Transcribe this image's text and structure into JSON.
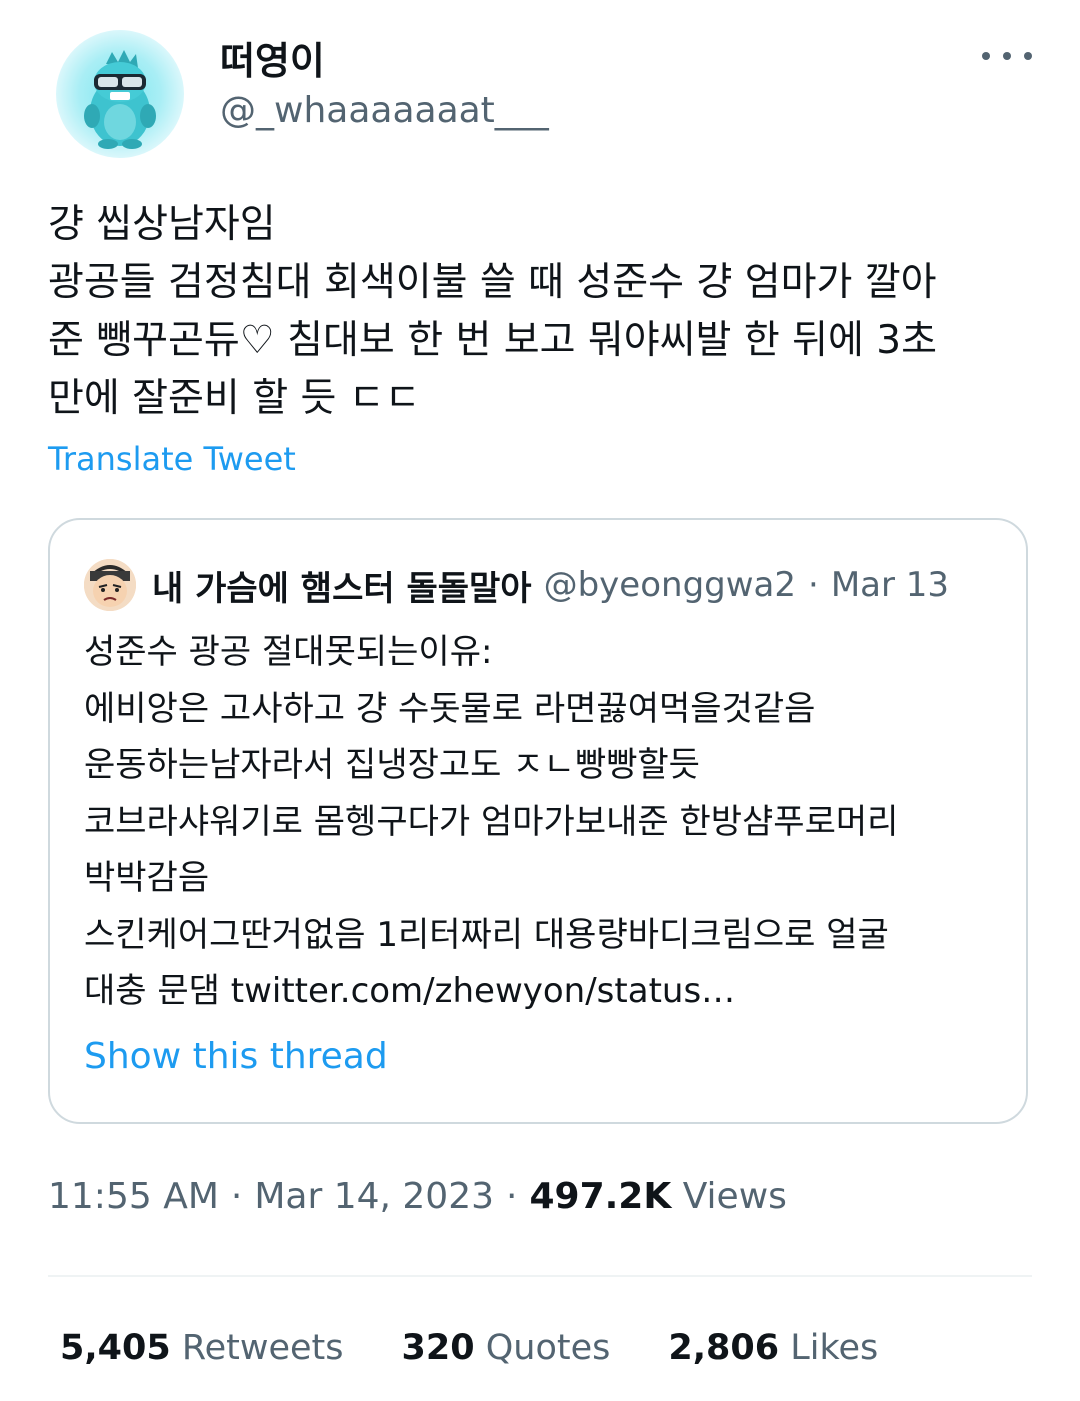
{
  "author": {
    "display_name": "떠영이",
    "handle": "@_whaaaaaaat___",
    "avatar_icon": "blue-monster-avatar"
  },
  "menu": {
    "more_icon": "more-horizontal-icon"
  },
  "tweet": {
    "text": "걍 씹상남자임\n광공들 검정침대 회색이불 쓸 때 성준수 걍 엄마가 깔아\n준 뺑꾸곤듀♡ 침대보 한 번 보고 뭐야씨발 한 뒤에 3초\n만에 잘준비 할 듯 ㄷㄷ",
    "translate_label": "Translate Tweet"
  },
  "quote": {
    "display_name": "내 가슴에 햄스터 돌돌말아",
    "handle": "@byeonggwa2",
    "separator": "·",
    "date": "Mar 13",
    "text": "성준수 광공 절대못되는이유:\n에비앙은 고사하고 걍 수돗물로 라면끓여먹을것같음\n운동하는남자라서 집냉장고도 ㅈㄴ빵빵할듯\n코브라샤워기로 몸헹구다가 엄마가보내준 한방샴푸로머리\n박박감음\n스킨케어그딴거없음 1리터짜리 대용량바디크림으로 얼굴\n대충 문댐 twitter.com/zhewyon/status…",
    "show_thread_label": "Show this thread"
  },
  "meta": {
    "time": "11:55 AM",
    "separator": "·",
    "date": "Mar 14, 2023",
    "views_count": "497.2K",
    "views_label": "Views"
  },
  "stats": {
    "retweets_count": "5,405",
    "retweets_label": "Retweets",
    "quotes_count": "320",
    "quotes_label": "Quotes",
    "likes_count": "2,806",
    "likes_label": "Likes"
  },
  "colors": {
    "link": "#1d9bf0",
    "secondary_text": "#536471",
    "primary_text": "#0f1419",
    "border": "#cfd9de"
  }
}
